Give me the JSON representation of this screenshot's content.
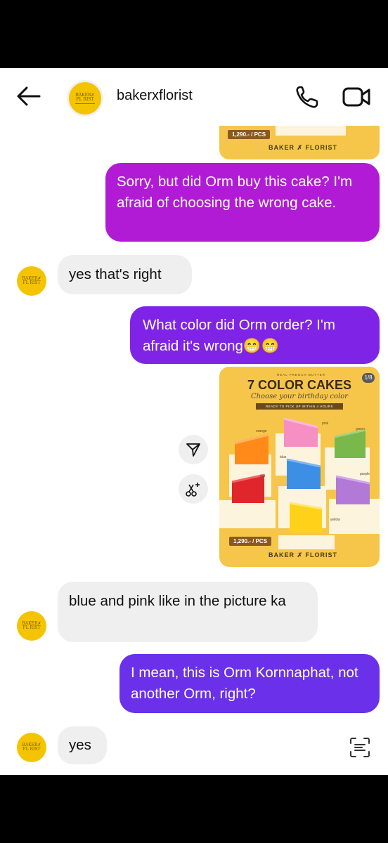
{
  "header": {
    "username": "bakerxflorist",
    "avatar_text_1": "BAKER✗",
    "avatar_text_2": "FL RIST"
  },
  "top_image": {
    "price": "1,290.- / PCS",
    "brand": "BAKER ✗ FLORIST"
  },
  "messages": [
    {
      "side": "out",
      "text": "Sorry, but did Orm buy this cake? I'm afraid of choosing the wrong cake."
    },
    {
      "side": "in",
      "text": "yes that's right"
    },
    {
      "side": "out",
      "text": "What color did Orm order? I'm afraid it's wrong😁😁"
    },
    {
      "side": "in",
      "text": "blue and pink like in the picture ka"
    },
    {
      "side": "out",
      "text": "I mean, this is Orm Kornnaphat, not another Orm, right?"
    },
    {
      "side": "in",
      "text": "yes"
    }
  ],
  "cake_image": {
    "badge": "REAL FRENCH BUTTER",
    "page_counter": "1/8",
    "title": "7 COLOR CAKES",
    "subtitle": "Choose your birthday color",
    "banner": "READY TO PICK UP WITHIN 4 HOURS",
    "price": "1,290.- / PCS",
    "brand": "BAKER ✗ FLORIST",
    "labels": {
      "orange": "orange",
      "pink": "pink",
      "green": "green",
      "blue": "blue",
      "red": "red",
      "purple": "purple",
      "yellow": "yellow"
    }
  },
  "colors": {
    "cake_orange": "#ff8a1a",
    "cake_pink": "#f58fc4",
    "cake_green": "#79b84a",
    "cake_blue": "#3d8fe6",
    "cake_red": "#e0262a",
    "cake_purple": "#b27ad6",
    "cake_yellow": "#ffd21a",
    "card_bg": "#f6c64a"
  },
  "icons": {
    "back": "arrow-left-icon",
    "call": "phone-icon",
    "video": "video-camera-icon",
    "share": "send-icon",
    "edit": "magic-edit-icon",
    "scan": "scan-text-icon"
  }
}
